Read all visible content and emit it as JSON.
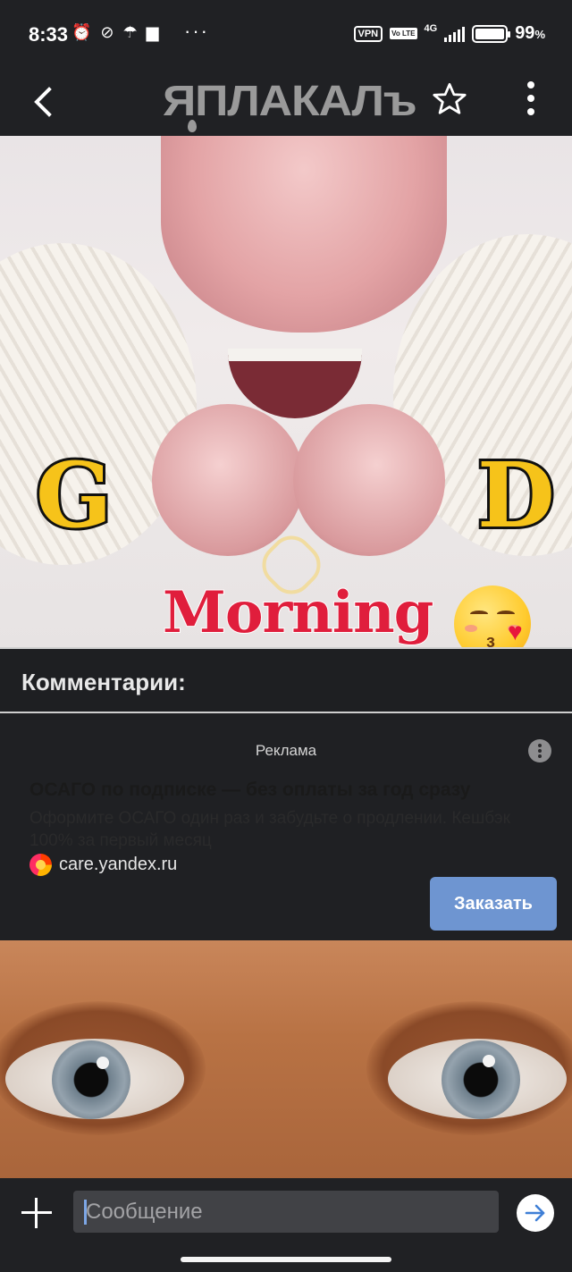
{
  "status_bar": {
    "time": "8:33",
    "vpn": "VPN",
    "volte": "Vo LTE",
    "network": "4G",
    "battery_percent": "99",
    "battery_unit": "%",
    "battery_level": 0.99,
    "icons": [
      "alarm-icon",
      "link-icon",
      "umbrella-icon",
      "clipboard-icon"
    ],
    "more": "···"
  },
  "app_bar": {
    "logo": "ЯПЛАКАЛъ",
    "icons": [
      "back-arrow-icon",
      "star-outline-icon",
      "more-vert-icon"
    ]
  },
  "post": {
    "image1_caption_letters": [
      "G",
      "D"
    ],
    "image1_caption_word": "Morning"
  },
  "comments": {
    "title": "Комментарии:"
  },
  "ad": {
    "label": "Реклама",
    "title": "ОСАГО по подписке — без оплаты за год сразу",
    "description": "Оформите ОСАГО один раз и забудьте о продлении. Кешбэк 100% за первый месяц",
    "source": "care.yandex.ru",
    "button": "Заказать",
    "button_color": "#6e95d1"
  },
  "composer": {
    "placeholder": "Сообщение",
    "icons": [
      "plus-icon",
      "send-arrow-icon"
    ]
  },
  "colors": {
    "background": "#1f2023",
    "accent": "#6e95d1",
    "logo": "#9a9a9a"
  }
}
